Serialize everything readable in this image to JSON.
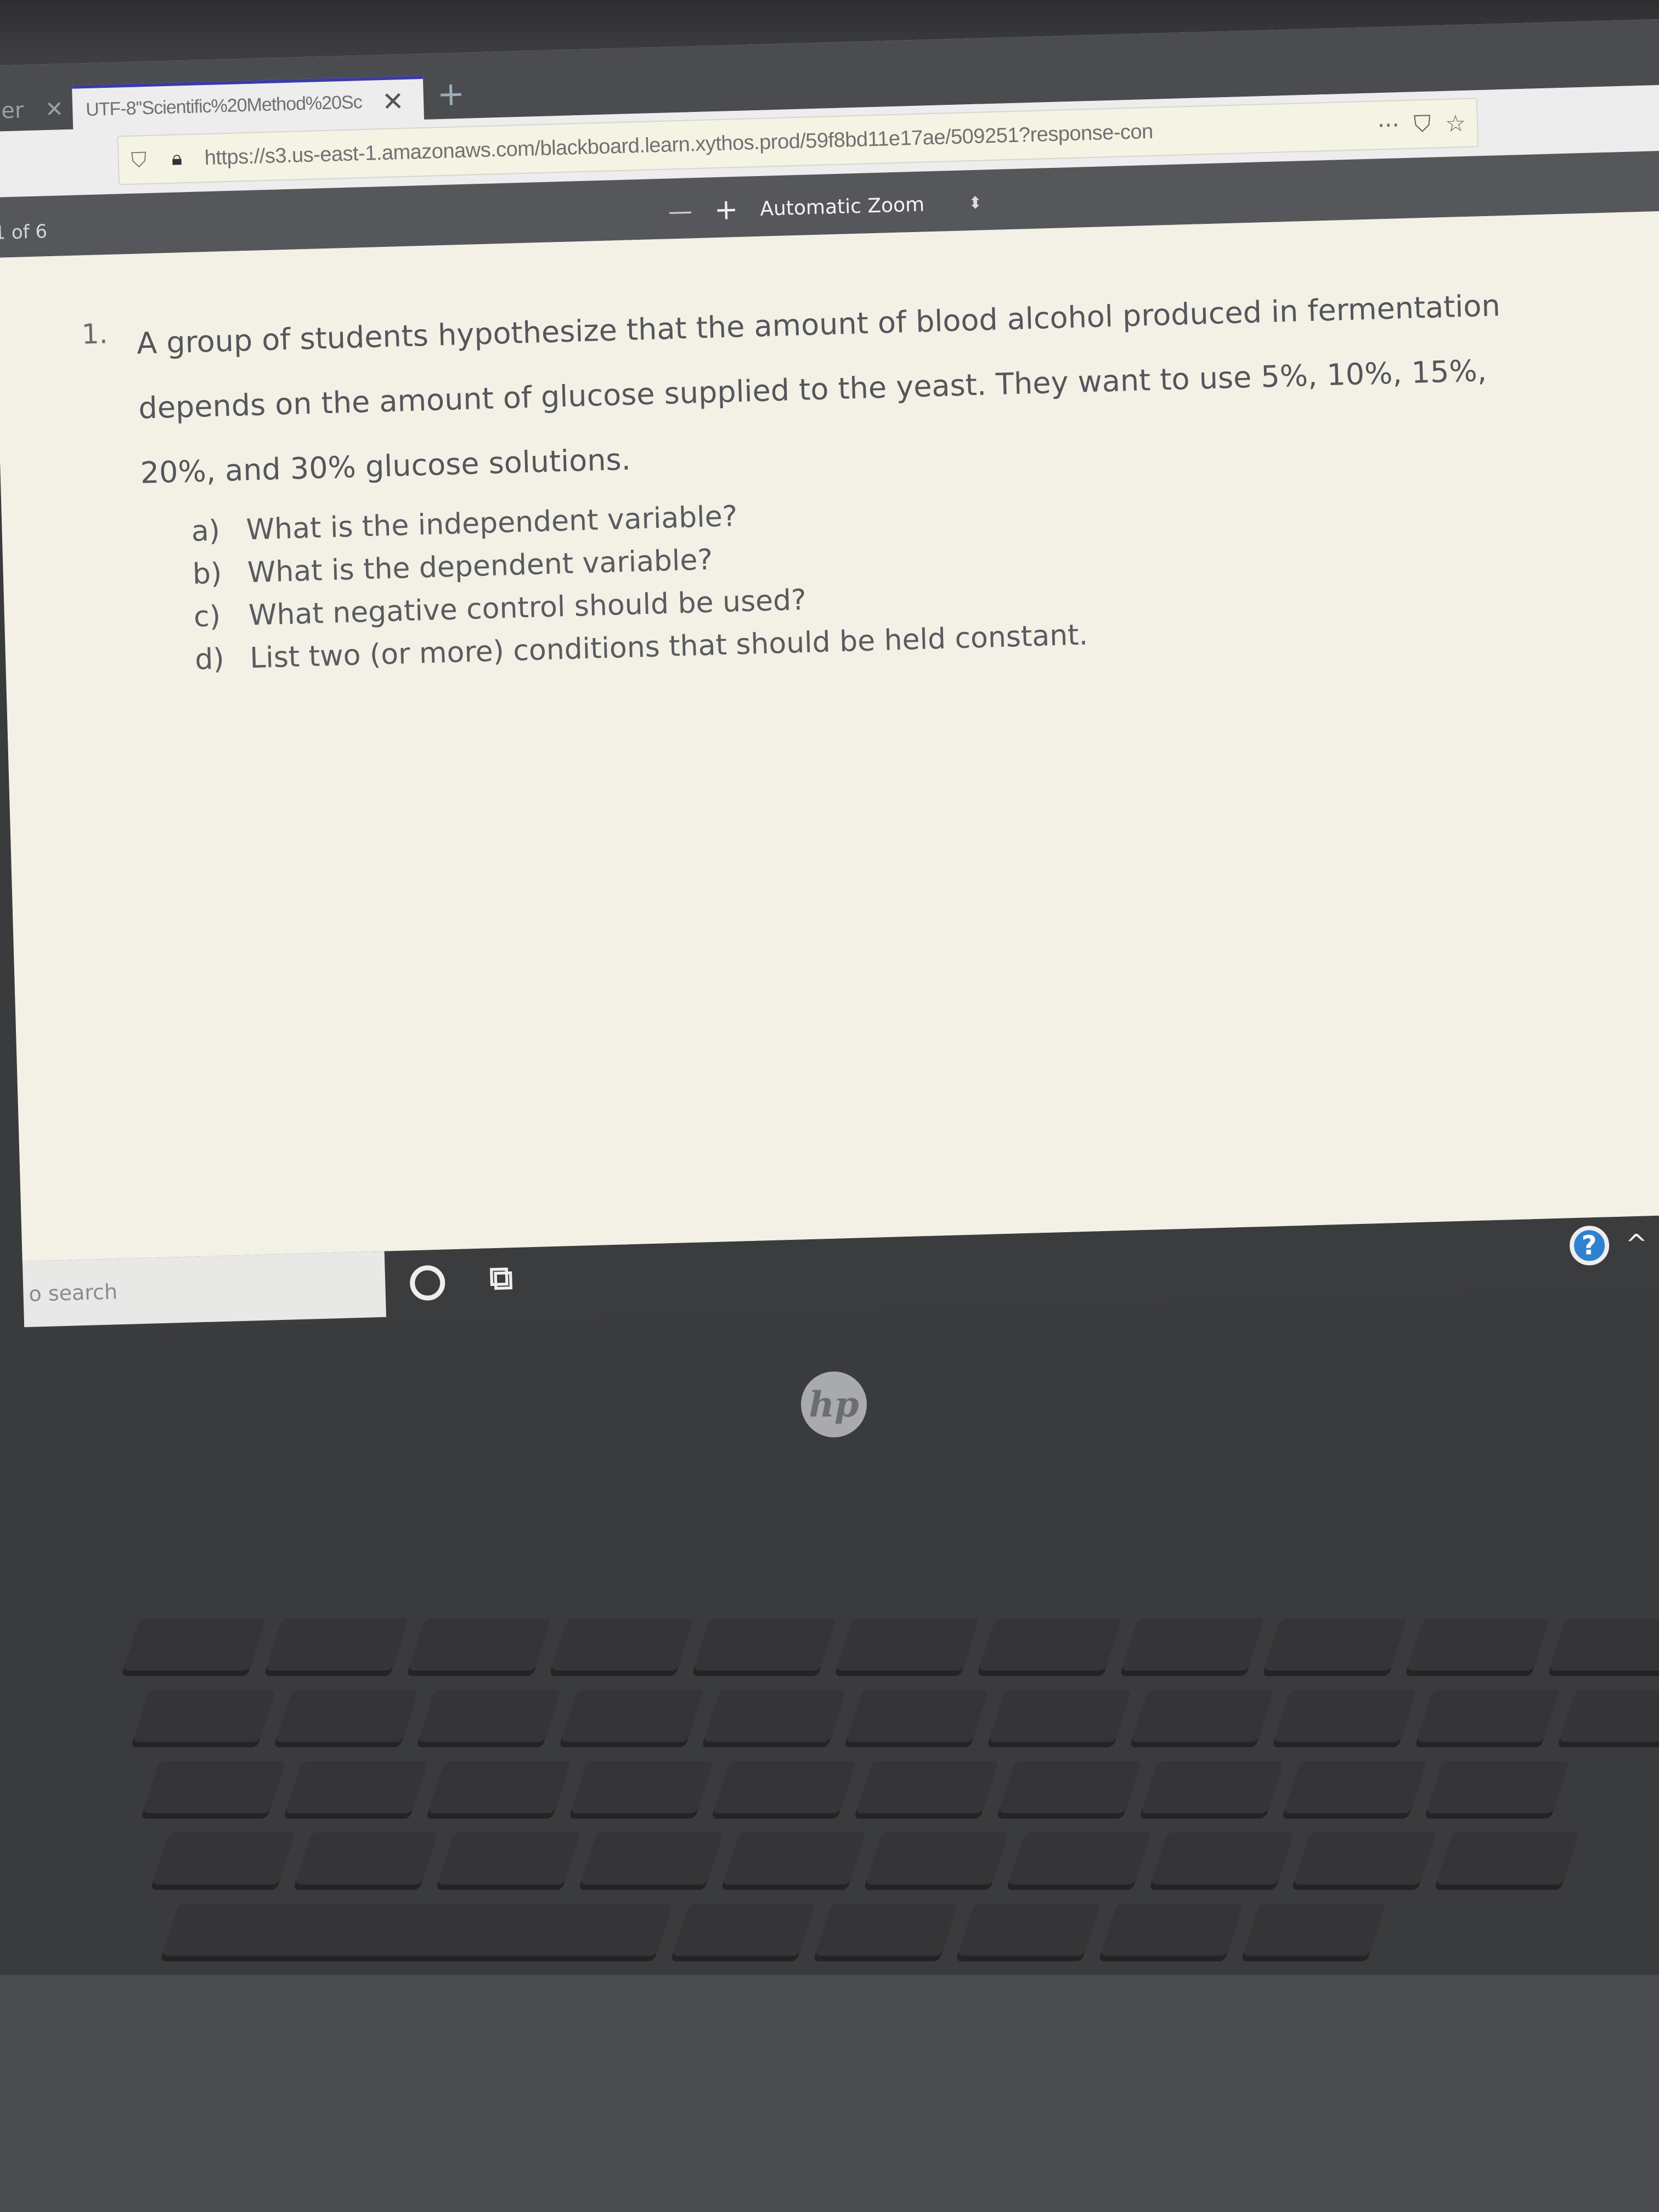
{
  "browser": {
    "prev_tab_fragment": "er",
    "prev_tab_close": "✕",
    "active_tab": {
      "title": "UTF-8''Scientific%20Method%20Sc",
      "close_glyph": "✕"
    },
    "new_tab_glyph": "+",
    "url": "https://s3.us-east-1.amazonaws.com/blackboard.learn.xythos.prod/59f8bd11e17ae/509251?response-con",
    "icons": {
      "shield": "shield-icon",
      "lock": "lock-icon",
      "more": "···",
      "pocket": "pocket-icon",
      "bookmark": "☆"
    }
  },
  "pdf_viewer": {
    "page_counter": "1 of 6",
    "zoom_out": "—",
    "zoom_in": "+",
    "zoom_level": "Automatic Zoom",
    "zoom_arrows": "⬍"
  },
  "document": {
    "question_number": "1.",
    "question_text": "A group of students hypothesize that the amount of blood alcohol produced in fermentation depends on the amount of glucose supplied to the yeast.  They want to use 5%, 10%, 15%, 20%, and 30% glucose solutions.",
    "sub_questions": [
      {
        "label": "a)",
        "text": "What is the independent variable?"
      },
      {
        "label": "b)",
        "text": "What is the dependent variable?"
      },
      {
        "label": "c)",
        "text": "What negative control should be used?"
      },
      {
        "label": "d)",
        "text": "List two (or more) conditions that should be held constant."
      }
    ]
  },
  "taskbar": {
    "search_placeholder": "o search",
    "cortana_icon": "circle",
    "task_view_icon": "task-view",
    "help_glyph": "?",
    "chevron_glyph": "^"
  },
  "laptop": {
    "brand": "hp"
  }
}
